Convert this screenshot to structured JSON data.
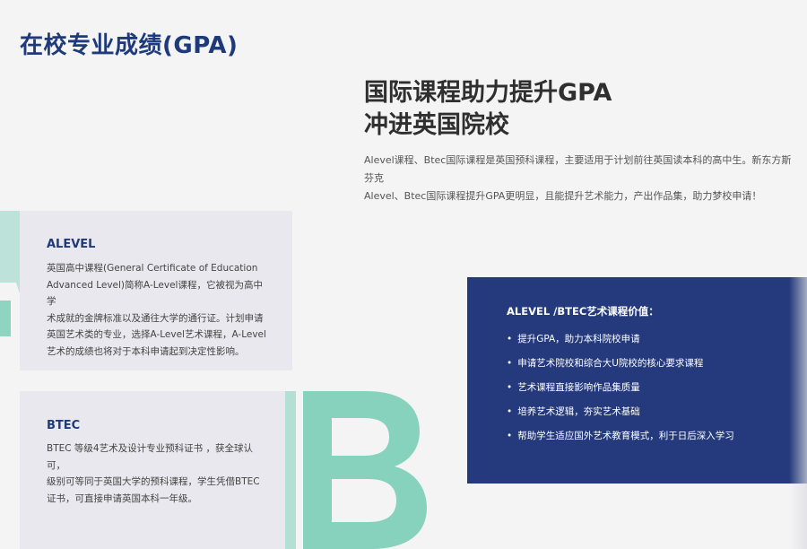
{
  "page_title": "在校专业成绩(GPA)",
  "hero": {
    "title_line1": "国际课程助力提升GPA",
    "title_line2": "冲进英国院校",
    "description_line1": "Alevel课程、Btec国际课程是英国预科课程，主要适用于计划前往英国读本科的高中生。新东方斯芬克",
    "description_line2": "Alevel、Btec国际课程提升GPA更明显，且能提升艺术能力，产出作品集，助力梦校申请！"
  },
  "alevel": {
    "title": "ALEVEL",
    "lines": [
      "英国高中课程(General Certificate of Education",
      "Advanced Level)简称A-Level课程，它被视为高中学",
      "术成就的金牌标准以及通往大学的通行证。计划申请",
      "英国艺术类的专业，选择A-Level艺术课程，A-Level",
      "艺术的成绩也将对于本科申请起到决定性影响。"
    ]
  },
  "btec": {
    "title": "BTEC",
    "lines": [
      "BTEC 等级4艺术及设计专业预科证书 ，获全球认可，",
      "级别可等同于英国大学的预科课程，学生凭借BTEC",
      "证书，可直接申请英国本科一年级。"
    ]
  },
  "value_panel": {
    "title": "ALEVEL /BTEC艺术课程价值：",
    "bullet": "•",
    "items": [
      "提升GPA，助力本科院校申请",
      "申请艺术院校和综合大U院校的核心要求课程",
      "艺术课程直接影响作品集质量",
      "培养艺术逻辑，夯实艺术基础",
      "帮助学生适应国外艺术教育模式，利于日后深入学习"
    ]
  },
  "decor": {
    "letter_a_color": "#8fd3c1",
    "letter_b_color": "#87d2bd",
    "accent_navy": "#253a7c"
  }
}
